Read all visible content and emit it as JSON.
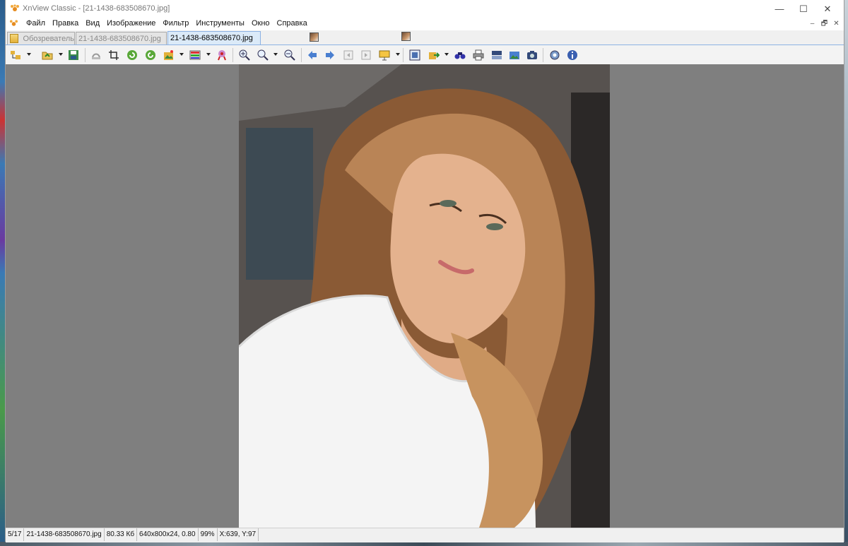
{
  "window": {
    "title": "XnView Classic - [21-1438-683508670.jpg]"
  },
  "window_controls": {
    "minimize": "—",
    "maximize": "☐",
    "close": "✕"
  },
  "menu": {
    "items": [
      "Файл",
      "Правка",
      "Вид",
      "Изображение",
      "Фильтр",
      "Инструменты",
      "Окно",
      "Справка"
    ],
    "mdi_controls": [
      "–",
      "🗗",
      "✕"
    ]
  },
  "tabs": [
    {
      "label": "Обозреватель",
      "icon": "folder-icon",
      "active": false
    },
    {
      "label": "21-1438-683508670.jpg",
      "icon": "photo-thumbnail-icon",
      "active": false
    },
    {
      "label": "21-1438-683508670.jpg",
      "icon": "photo-thumbnail-icon",
      "active": true
    }
  ],
  "toolbar": {
    "buttons": [
      "browser-icon",
      "open-folder-icon",
      "save-icon",
      "undo-icon",
      "crop-icon",
      "rotate-left-icon",
      "rotate-right-icon",
      "adjust-icon",
      "color-balance-icon",
      "red-eye-icon",
      "zoom-in-icon",
      "zoom-icon",
      "zoom-out-icon",
      "previous-icon",
      "next-icon",
      "first-page-icon",
      "last-page-icon",
      "slideshow-icon",
      "fullscreen-icon",
      "export-icon",
      "find-icon",
      "print-icon",
      "scan-icon",
      "capture-icon",
      "screenshot-icon",
      "settings-icon",
      "info-icon"
    ]
  },
  "colors": {
    "accent": "#8db2e3",
    "viewer_background": "#7f7f7f",
    "active_tab": "#dbeaf8"
  },
  "statusbar": {
    "position": "5/17",
    "filename": "21-1438-683508670.jpg",
    "filesize": "80.33 Кб",
    "dimensions": "640x800x24, 0.80",
    "zoom": "99%",
    "coords": "X:639, Y:97"
  }
}
